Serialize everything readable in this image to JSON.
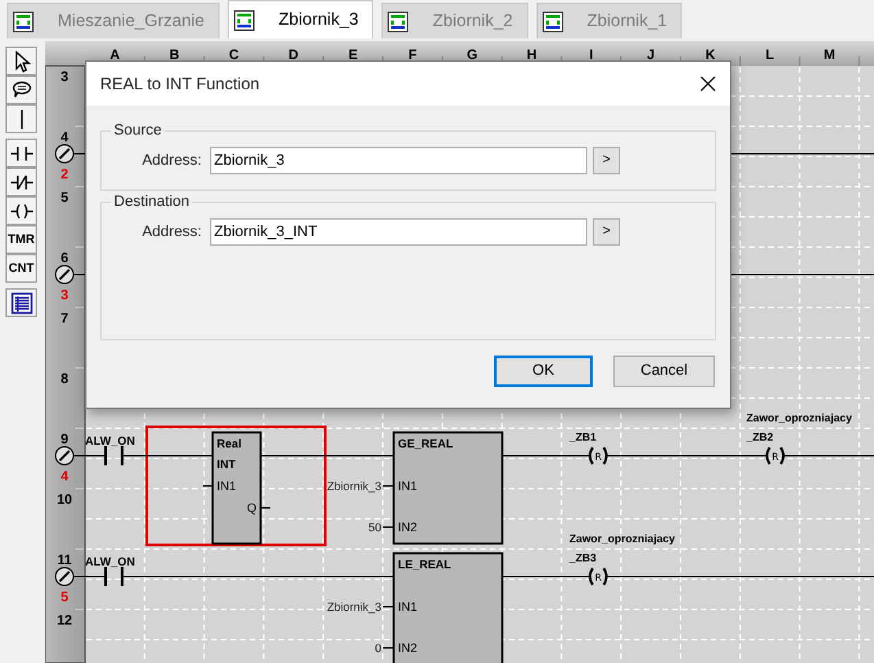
{
  "tabs": [
    {
      "label": "Mieszanie_Grzanie",
      "selected": false
    },
    {
      "label": "Zbiornik_3",
      "selected": true
    },
    {
      "label": "Zbiornik_2",
      "selected": false
    },
    {
      "label": "Zbiornik_1",
      "selected": false
    }
  ],
  "toolbar": [
    {
      "kind": "pointer"
    },
    {
      "kind": "comment"
    },
    {
      "kind": "line"
    },
    {
      "kind": "contact"
    },
    {
      "kind": "nc-contact"
    },
    {
      "kind": "coil"
    },
    {
      "kind": "text",
      "label": "TMR"
    },
    {
      "kind": "text",
      "label": "CNT"
    },
    {
      "kind": "table"
    }
  ],
  "columns": [
    "A",
    "B",
    "C",
    "D",
    "E",
    "F",
    "G",
    "H",
    "I",
    "J",
    "K",
    "L",
    "M"
  ],
  "rows": [
    {
      "number": "3"
    },
    {
      "number": "4",
      "rung": "2"
    },
    {
      "number": "5"
    },
    {
      "number": "6",
      "rung": "3"
    },
    {
      "number": "7"
    },
    {
      "number": "8"
    },
    {
      "number": "9",
      "rung": "4",
      "network": {
        "contact": "ALW_ON",
        "blocks": [
          {
            "kind": "convert",
            "selected": true,
            "title": "Real",
            "subtitle": "INT",
            "inputs": [
              {
                "pin": "IN1"
              }
            ],
            "outputs": [
              {
                "pin": "Q"
              }
            ]
          },
          {
            "kind": "compare",
            "selected": false,
            "title": "GE_REAL",
            "inputs": [
              {
                "value": "Zbiornik_3",
                "pin": "IN1"
              },
              {
                "value": "50",
                "pin": "IN2"
              }
            ]
          }
        ],
        "coils": [
          {
            "symbol": "R",
            "labels": [
              "_ZB1"
            ]
          },
          {
            "symbol": "R",
            "labels": [
              "Zawor_oprozniajacy",
              "_ZB2"
            ]
          }
        ]
      }
    },
    {
      "number": "10"
    },
    {
      "number": "11",
      "rung": "5",
      "network": {
        "contact": "ALW_ON",
        "blocks": [
          {
            "kind": "compare",
            "selected": false,
            "title": "LE_REAL",
            "inputs": [
              {
                "value": "Zbiornik_3",
                "pin": "IN1"
              },
              {
                "value": "0",
                "pin": "IN2"
              }
            ]
          }
        ],
        "coils": [
          {
            "symbol": "R",
            "labels": [
              "Zawor_oprozniajacy",
              "_ZB3"
            ]
          }
        ]
      }
    },
    {
      "number": "12"
    }
  ],
  "dialog": {
    "title": "REAL to INT Function",
    "groups": [
      {
        "legend": "Source",
        "label": "Address:",
        "value": "Zbiornik_3",
        "browse": ">"
      },
      {
        "legend": "Destination",
        "label": "Address:",
        "value": "Zbiornik_3_INT",
        "browse": ">"
      }
    ],
    "buttons": [
      {
        "label": "OK",
        "default": true
      },
      {
        "label": "Cancel",
        "default": false
      }
    ]
  }
}
